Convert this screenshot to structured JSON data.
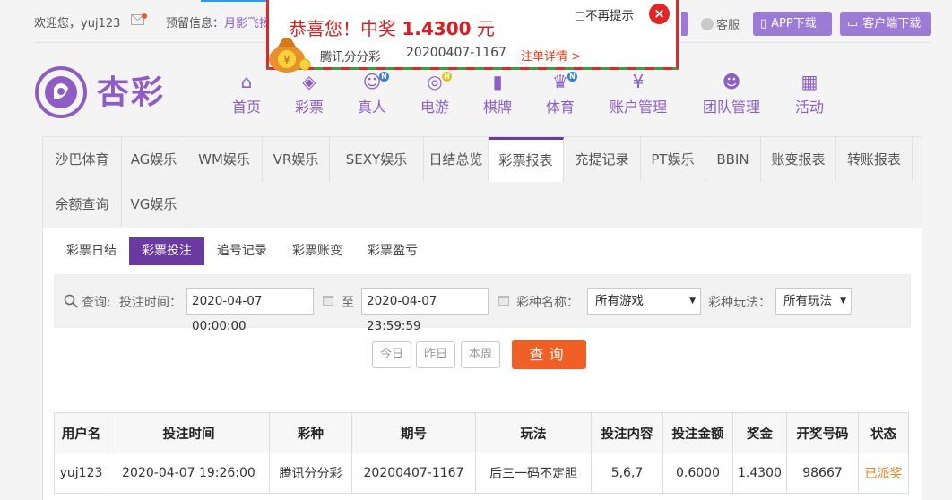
{
  "topbar": {
    "welcome_prefix": "欢迎您，",
    "username": "yuj123",
    "notice_label": "预留信息：",
    "notice_text": "月影飞扬",
    "kefu_label": "客服",
    "app_download": "APP下载",
    "client_download": "客户端下载"
  },
  "logo": {
    "text": "杏彩"
  },
  "nav": [
    {
      "label": "首页",
      "icon": "home-icon",
      "badge": ""
    },
    {
      "label": "彩票",
      "icon": "lottery-ticket-icon",
      "badge": ""
    },
    {
      "label": "真人",
      "icon": "live-dealer-icon",
      "badge": "N"
    },
    {
      "label": "电游",
      "icon": "gamepad-icon",
      "badge": "H"
    },
    {
      "label": "棋牌",
      "icon": "cards-icon",
      "badge": ""
    },
    {
      "label": "体育",
      "icon": "trophy-icon",
      "badge": "N"
    },
    {
      "label": "账户管理",
      "icon": "yen-coin-icon",
      "badge": ""
    },
    {
      "label": "团队管理",
      "icon": "team-icon",
      "badge": ""
    },
    {
      "label": "活动",
      "icon": "gift-icon",
      "badge": ""
    }
  ],
  "tabs": [
    "沙巴体育",
    "AG娱乐",
    "WM娱乐",
    "VR娱乐",
    "SEXY娱乐",
    "日结总览",
    "彩票报表",
    "充提记录",
    "PT娱乐",
    "BBIN",
    "账变报表",
    "转账报表",
    "余额查询",
    "VG娱乐"
  ],
  "active_tab": "彩票报表",
  "subtabs": [
    "彩票日结",
    "彩票投注",
    "追号记录",
    "彩票账变",
    "彩票盈亏"
  ],
  "active_subtab": "彩票投注",
  "filter": {
    "query_label": "查询:",
    "time_label": "投注时间：",
    "start_time": "2020-04-07 00:00:00",
    "to_label": "至",
    "end_time": "2020-04-07 23:59:59",
    "lottery_name_label": "彩种名称：",
    "lottery_name_value": "所有游戏",
    "play_label": "彩种玩法：",
    "play_value": "所有玩法"
  },
  "quick_buttons": [
    "今日",
    "昨日",
    "本周"
  ],
  "query_button": "查询",
  "table": {
    "headers": [
      "用户名",
      "投注时间",
      "彩种",
      "期号",
      "玩法",
      "投注内容",
      "投注金额",
      "奖金",
      "开奖号码",
      "状态"
    ],
    "rows": [
      [
        "yuj123",
        "2020-04-07 19:26:00",
        "腾讯分分彩",
        "20200407-1167",
        "后三一码不定胆",
        "5,6,7",
        "0.6000",
        "1.4300",
        "98667",
        "已派奖"
      ]
    ]
  },
  "popup": {
    "title_prefix": "恭喜您！中奖",
    "amount": "1.4300",
    "unit": "元",
    "lottery": "腾讯分分彩",
    "issue": "20200407-1167",
    "detail_link": "注单详情 >",
    "no_remind": "不再提示",
    "close": "×"
  },
  "colors": {
    "brand_purple": "#8d5ec8",
    "active_purple": "#6a3aa1",
    "query_orange": "#f05f24",
    "status_orange": "#ef7e21",
    "popup_red": "#d81e1e"
  }
}
